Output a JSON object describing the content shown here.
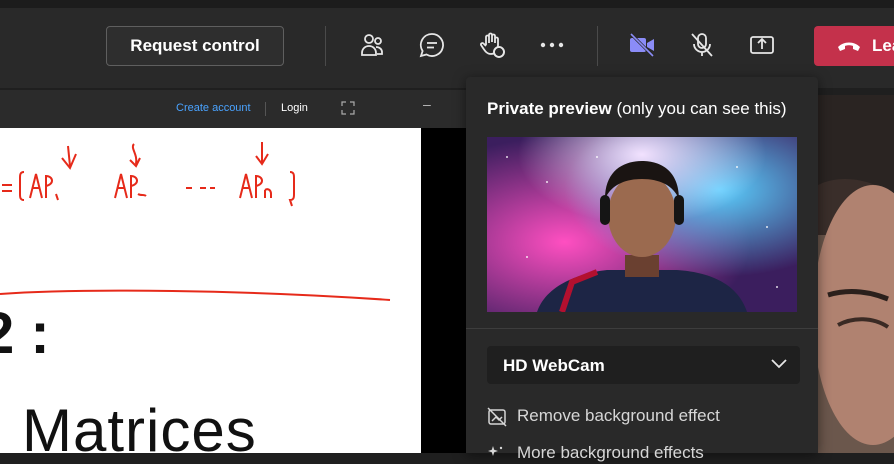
{
  "toolbar": {
    "request_control_label": "Request control",
    "icons": [
      "people-icon",
      "chat-icon",
      "raise-hand-icon",
      "more-icon",
      "camera-icon",
      "mic-off-icon",
      "share-icon"
    ],
    "leave_label": "Lea",
    "leave_color": "#c4314b",
    "camera_color": "#8b8cf7"
  },
  "shared_screen": {
    "create_account": "Create account",
    "login": "Login",
    "link_color": "#4aa3ff",
    "whiteboard_text": {
      "colon_line": "2 :",
      "title": "Matrices"
    }
  },
  "preview_panel": {
    "title_bold": "Private preview",
    "title_rest": " (only you can see this)",
    "camera_select_value": "HD WebCam",
    "options": [
      {
        "label": "Remove background effect",
        "icon": "no-background-icon"
      },
      {
        "label": "More background effects",
        "icon": "sparkle-icon"
      }
    ]
  }
}
